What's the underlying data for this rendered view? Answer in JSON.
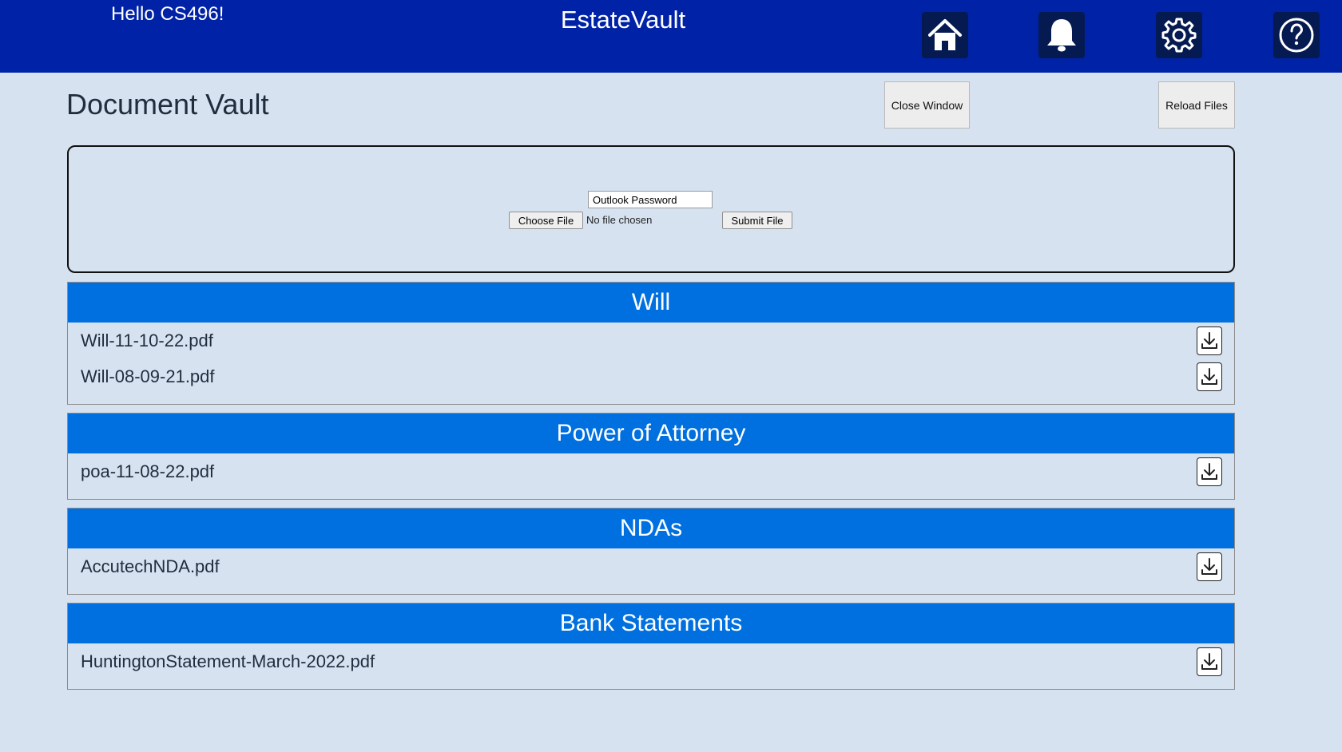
{
  "header": {
    "greeting": "Hello CS496!",
    "app_title": "EstateVault",
    "nav_icons": [
      "home-icon",
      "bell-icon",
      "gear-icon",
      "help-icon"
    ]
  },
  "page": {
    "title": "Document Vault",
    "close_window_label": "Close Window",
    "reload_files_label": "Reload Files"
  },
  "upload": {
    "name_value": "Outlook Password",
    "choose_file_label": "Choose File",
    "no_file_text": "No file chosen",
    "submit_label": "Submit File"
  },
  "sections": [
    {
      "title": "Will",
      "files": [
        "Will-11-10-22.pdf",
        "Will-08-09-21.pdf"
      ]
    },
    {
      "title": "Power of Attorney",
      "files": [
        "poa-11-08-22.pdf"
      ]
    },
    {
      "title": "NDAs",
      "files": [
        "AccutechNDA.pdf"
      ]
    },
    {
      "title": "Bank Statements",
      "files": [
        "HuntingtonStatement-March-2022.pdf"
      ]
    }
  ],
  "colors": {
    "topbar": "#0022a6",
    "section_header": "#0070e0",
    "background": "#d6e2f0"
  }
}
